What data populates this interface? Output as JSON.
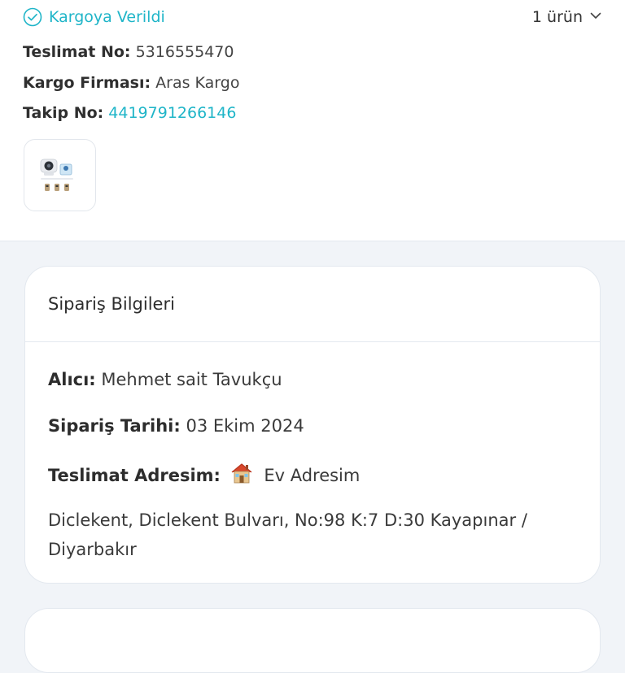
{
  "shipment": {
    "status": "Kargoya Verildi",
    "item_count": "1 ürün",
    "delivery_no_label": "Teslimat No:",
    "delivery_no": "5316555470",
    "carrier_label": "Kargo Firması:",
    "carrier": "Aras Kargo",
    "tracking_label": "Takip No:",
    "tracking_no": "4419791266146",
    "product_image_icon": "camera-product-thumbnail"
  },
  "order_info": {
    "title": "Sipariş Bilgileri",
    "recipient_label": "Alıcı:",
    "recipient": "Mehmet sait Tavukçu",
    "order_date_label": "Sipariş Tarihi:",
    "order_date": "03 Ekim 2024",
    "address_label": "Teslimat Adresim:",
    "address_name": "Ev Adresim",
    "address_icon": "house-icon",
    "address_text": "Diclekent, Diclekent Bulvarı, No:98 K:7 D:30 Kayapınar / Diyarbakır"
  },
  "colors": {
    "accent": "#1fb5c8",
    "background": "#f1f4f8",
    "card": "#ffffff"
  }
}
